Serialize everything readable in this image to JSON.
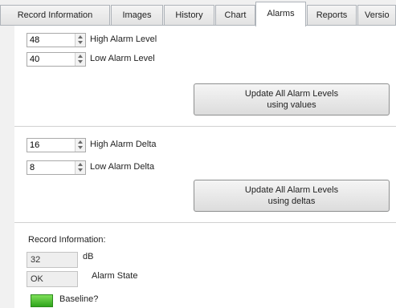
{
  "tabs": [
    {
      "label": "Record Information",
      "active": false
    },
    {
      "label": "Images",
      "active": false
    },
    {
      "label": "History",
      "active": false
    },
    {
      "label": "Chart",
      "active": false
    },
    {
      "label": "Alarms",
      "active": true
    },
    {
      "label": "Reports",
      "active": false
    },
    {
      "label": "Versio",
      "active": false
    }
  ],
  "levels": {
    "high_value": "48",
    "high_label": "High Alarm Level",
    "low_value": "40",
    "low_label": "Low Alarm Level",
    "update_button_line1": "Update All Alarm Levels",
    "update_button_line2": "using values"
  },
  "deltas": {
    "high_value": "16",
    "high_label": "High Alarm Delta",
    "low_value": "8",
    "low_label": "Low Alarm Delta",
    "update_button_line1": "Update All Alarm Levels",
    "update_button_line2": "using deltas"
  },
  "record_info": {
    "heading": "Record Information:",
    "reading_value": "32",
    "reading_unit": "dB",
    "state_value": "OK",
    "state_label": "Alarm State",
    "baseline_label": "Baseline?",
    "baseline_color": "#3bb526"
  }
}
